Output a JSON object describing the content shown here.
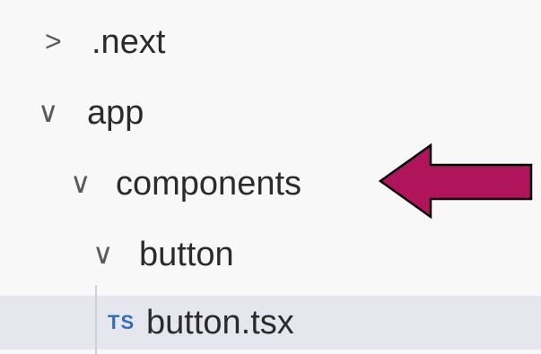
{
  "explorer": {
    "items": [
      {
        "label": ".next",
        "chevron": "chevron-right-icon"
      },
      {
        "label": "app",
        "chevron": "chevron-down-icon"
      },
      {
        "label": "components",
        "chevron": "chevron-down-icon"
      },
      {
        "label": "button",
        "chevron": "chevron-down-icon"
      },
      {
        "label": "button.tsx",
        "badge": "TS",
        "selected": true
      }
    ]
  },
  "chevrons": {
    "collapsed": ">",
    "expanded": "∨"
  },
  "colors": {
    "arrow_fill": "#b0145a",
    "arrow_stroke": "#000000",
    "selection": "#e6e6ef",
    "ts_badge": "#2f6fbd"
  }
}
